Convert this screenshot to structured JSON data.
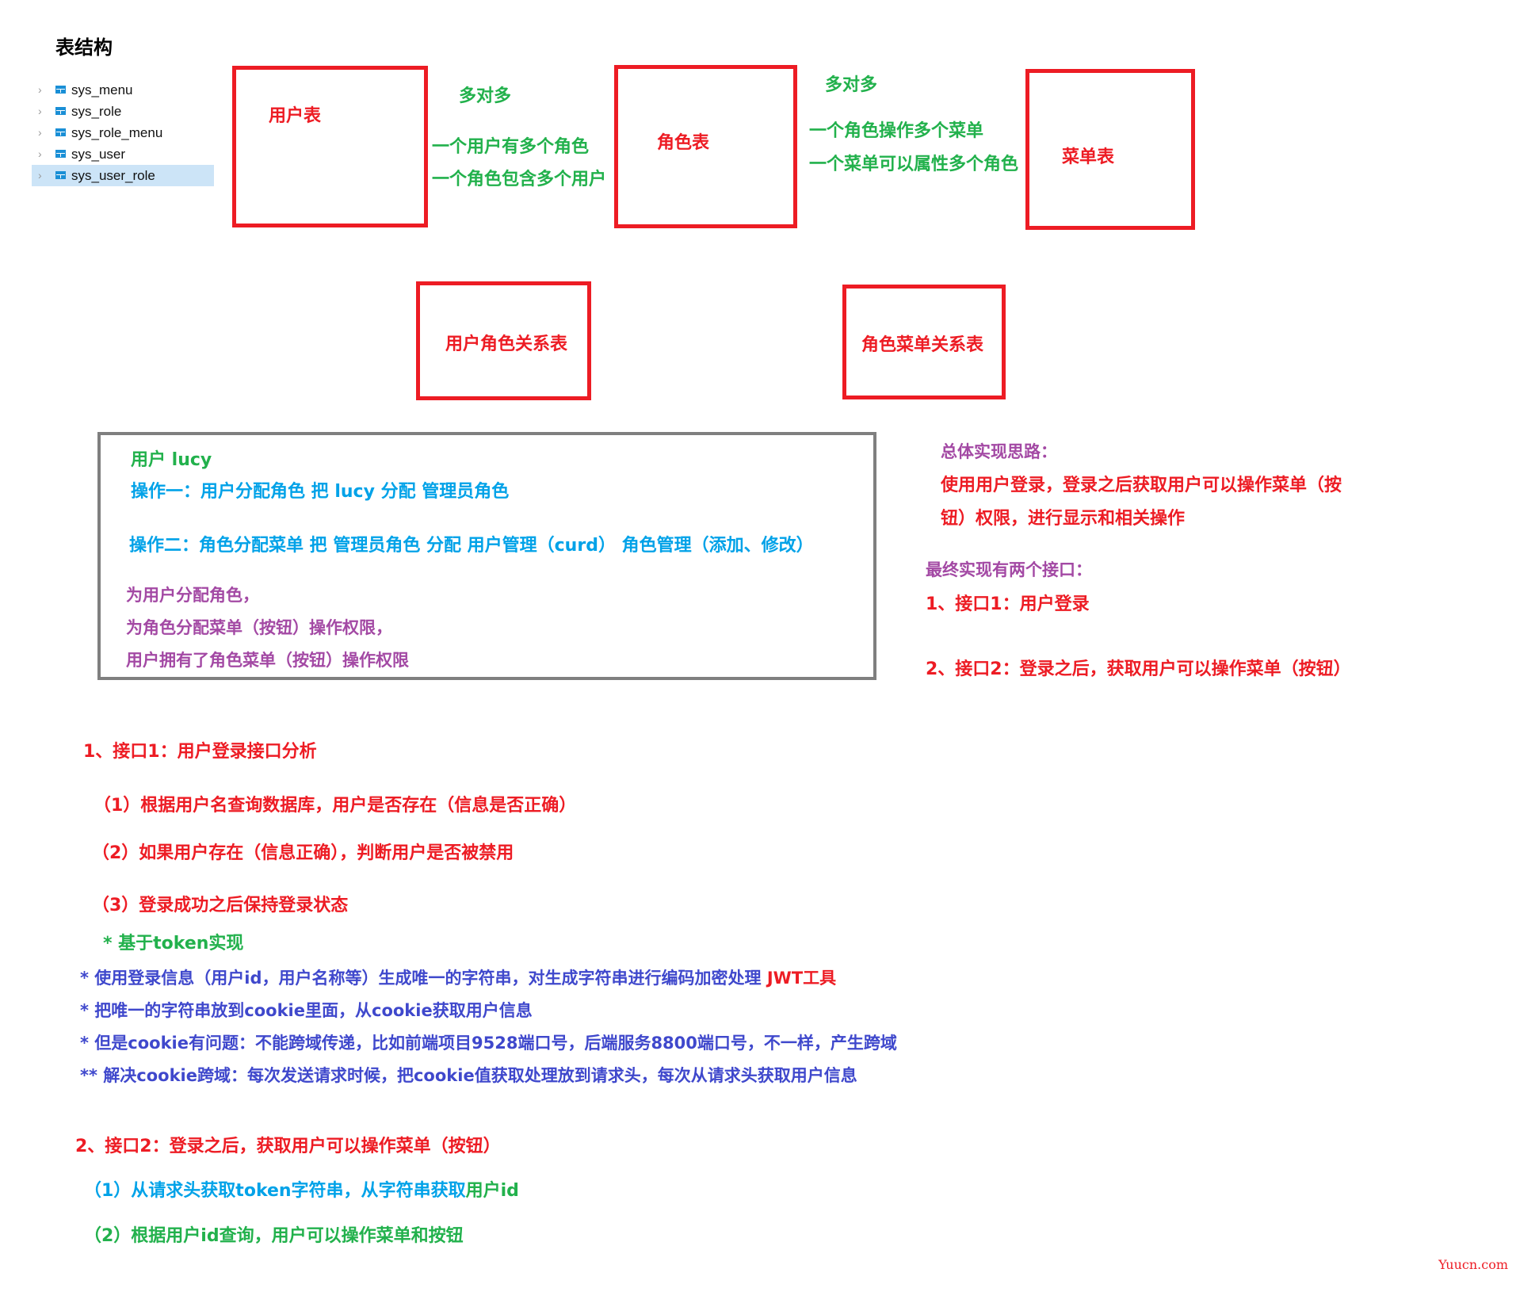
{
  "title": "表结构",
  "tree": {
    "items": [
      {
        "label": "sys_menu",
        "icon": "table-icon",
        "selected": false
      },
      {
        "label": "sys_role",
        "icon": "table-icon",
        "selected": false
      },
      {
        "label": "sys_role_menu",
        "icon": "table-icon",
        "selected": false
      },
      {
        "label": "sys_user",
        "icon": "table-icon",
        "selected": false
      },
      {
        "label": "sys_user_role",
        "icon": "table-icon",
        "selected": true
      }
    ],
    "chevron": "›"
  },
  "diagram": {
    "user_table": "用户表",
    "role_table": "角色表",
    "menu_table": "菜单表",
    "user_role_table": "用户角色关系表",
    "role_menu_table": "角色菜单关系表",
    "rel1": {
      "type": "多对多",
      "line1": "一个用户有多个角色",
      "line2": "一个角色包含多个用户"
    },
    "rel2": {
      "type": "多对多",
      "line1": "一个角色操作多个菜单",
      "line2": "一个菜单可以属性多个角色"
    }
  },
  "example_box": {
    "user": "用户 lucy",
    "op1": "操作一：用户分配角色   把 lucy 分配 管理员角色",
    "op2": "操作二：角色分配菜单  把 管理员角色  分配 用户管理（curd）  角色管理（添加、修改）",
    "summary": [
      "为用户分配角色，",
      "为角色分配菜单（按钮）操作权限，",
      "用户拥有了角色菜单（按钮）操作权限"
    ]
  },
  "overall": {
    "heading": "总体实现思路：",
    "line1": "使用用户登录，登录之后获取用户可以操作菜单（按",
    "line2": "钮）权限，进行显示和相关操作",
    "interfaces_heading": "最终实现有两个接口：",
    "interface1": "1、接口1：用户登录",
    "interface2": "2、接口2：登录之后，获取用户可以操作菜单（按钮）"
  },
  "section1": {
    "heading": "1、接口1：用户登录接口分析",
    "step1": "（1）根据用户名查询数据库，用户是否存在（信息是否正确）",
    "step2": "（2）如果用户存在（信息正确），判断用户是否被禁用",
    "step3": "（3）登录成功之后保持登录状态",
    "token_note": "* 基于token实现",
    "notes": [
      {
        "text": "* 使用登录信息（用户id，用户名称等）生成唯一的字符串，对生成字符串进行编码加密处理 ",
        "highlight": "JWT工具"
      },
      {
        "text": "* 把唯一的字符串放到cookie里面，从cookie获取用户信息",
        "highlight": ""
      },
      {
        "text": "* 但是cookie有问题：不能跨域传递，比如前端项目9528端口号，后端服务8800端口号，不一样，产生跨域",
        "highlight": ""
      },
      {
        "text": "** 解决cookie跨域：每次发送请求时候，把cookie值获取处理放到请求头，每次从请求头获取用户信息",
        "highlight": ""
      }
    ]
  },
  "section2": {
    "heading": "2、接口2：登录之后，获取用户可以操作菜单（按钮）",
    "step1_a": "（1）从请求头获取token字符串，从字符串获取",
    "step1_b": "用户id",
    "step2": "（2）根据用户id查询，用户可以操作菜单和按钮"
  },
  "watermark": "Yuucn.com",
  "colors": {
    "red": "#ed1c24",
    "green": "#22b14c",
    "blue": "#00a2e8",
    "purple": "#a349a4",
    "indigo": "#3f48cc",
    "gray_border": "#7f7f7f",
    "selection": "#cce4f7"
  }
}
